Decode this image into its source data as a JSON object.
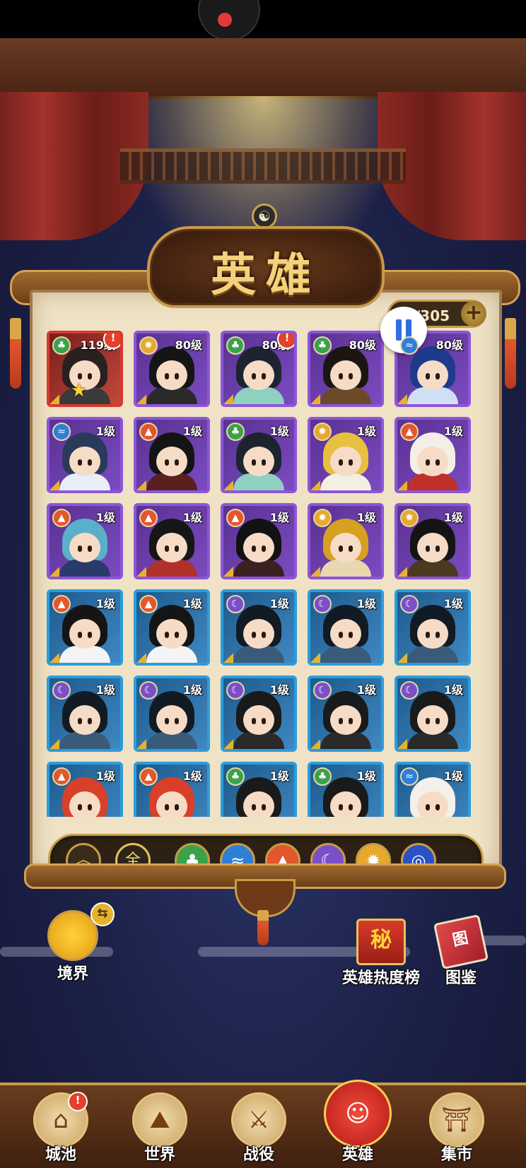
{
  "header": {
    "title": "英雄",
    "hero_count": "/305",
    "add_symbol": "+",
    "yinyang_symbol": "☯"
  },
  "colors": {
    "purple_rarity": "#8e55d8",
    "blue_rarity": "#2c9ddc",
    "red_rarity": "#d63a2e",
    "wood": "#3aa24a",
    "water": "#2f7fd6",
    "fire": "#e2572c",
    "moon": "#7a4fc8",
    "light": "#e6a92e",
    "wind": "#2a52c2"
  },
  "elements": {
    "wood": {
      "glyph": "♣",
      "color": "#3aa24a"
    },
    "water": {
      "glyph": "≈",
      "color": "#2f7fd6"
    },
    "fire": {
      "glyph": "▲",
      "color": "#e2572c"
    },
    "moon": {
      "glyph": "☾",
      "color": "#7a4fc8"
    },
    "light": {
      "glyph": "✹",
      "color": "#e6a92e"
    },
    "wind": {
      "glyph": "◎",
      "color": "#2a52c2"
    }
  },
  "heroes": [
    {
      "level": "119级",
      "element": "wood",
      "rarity": "red",
      "alert": "!",
      "star": "★",
      "hair": "#2a2020",
      "outfit": "#3a3a3a"
    },
    {
      "level": "80级",
      "element": "light",
      "rarity": "purple",
      "hair": "#151515",
      "outfit": "#2a2a2a"
    },
    {
      "level": "80级",
      "element": "wood",
      "rarity": "purple",
      "alert": "!",
      "hair": "#1d2430",
      "outfit": "#8fd0c0"
    },
    {
      "level": "80级",
      "element": "wood",
      "rarity": "purple",
      "hair": "#1b1612",
      "outfit": "#6b4a2a"
    },
    {
      "level": "80级",
      "element": "water",
      "rarity": "purple",
      "hair": "#1f3a8a",
      "outfit": "#cfe0f4"
    },
    {
      "level": "1级",
      "element": "water",
      "rarity": "purple",
      "hair": "#2a3a5a",
      "outfit": "#e8eef6"
    },
    {
      "level": "1级",
      "element": "fire",
      "rarity": "purple",
      "hair": "#141414",
      "outfit": "#5a2020"
    },
    {
      "level": "1级",
      "element": "wood",
      "rarity": "purple",
      "hair": "#1d2430",
      "outfit": "#8fd0c0"
    },
    {
      "level": "1级",
      "element": "light",
      "rarity": "purple",
      "hair": "#e8c040",
      "outfit": "#f4f0e0"
    },
    {
      "level": "1级",
      "element": "fire",
      "rarity": "purple",
      "hair": "#f4eee6",
      "outfit": "#c0302a"
    },
    {
      "level": "1级",
      "element": "fire",
      "rarity": "purple",
      "hair": "#5ab0c8",
      "outfit": "#2a3a6a"
    },
    {
      "level": "1级",
      "element": "fire",
      "rarity": "purple",
      "hair": "#161616",
      "outfit": "#b0302a"
    },
    {
      "level": "1级",
      "element": "fire",
      "rarity": "purple",
      "hair": "#121212",
      "outfit": "#3a2020"
    },
    {
      "level": "1级",
      "element": "light",
      "rarity": "purple",
      "hair": "#d8a020",
      "outfit": "#e8d8b0"
    },
    {
      "level": "1级",
      "element": "light",
      "rarity": "purple",
      "hair": "#141414",
      "outfit": "#4a3a20"
    },
    {
      "level": "1级",
      "element": "fire",
      "rarity": "blue",
      "hair": "#151515",
      "outfit": "#f4f4f4"
    },
    {
      "level": "1级",
      "element": "fire",
      "rarity": "blue",
      "hair": "#151515",
      "outfit": "#f4f4f4"
    },
    {
      "level": "1级",
      "element": "moon",
      "rarity": "blue",
      "hair": "#121a24",
      "outfit": "#3a5a7a"
    },
    {
      "level": "1级",
      "element": "moon",
      "rarity": "blue",
      "hair": "#121a24",
      "outfit": "#3a5a7a"
    },
    {
      "level": "1级",
      "element": "moon",
      "rarity": "blue",
      "hair": "#121a24",
      "outfit": "#3a5a7a"
    },
    {
      "level": "1级",
      "element": "moon",
      "rarity": "blue",
      "hair": "#121a24",
      "outfit": "#3a5a7a"
    },
    {
      "level": "1级",
      "element": "moon",
      "rarity": "blue",
      "hair": "#121a24",
      "outfit": "#3a5a7a"
    },
    {
      "level": "1级",
      "element": "moon",
      "rarity": "blue",
      "hair": "#1a1a1a",
      "outfit": "#2a2a2a"
    },
    {
      "level": "1级",
      "element": "moon",
      "rarity": "blue",
      "hair": "#1a1a1a",
      "outfit": "#2a2a2a"
    },
    {
      "level": "1级",
      "element": "moon",
      "rarity": "blue",
      "hair": "#1a1a1a",
      "outfit": "#2a2a2a"
    },
    {
      "level": "1级",
      "element": "fire",
      "rarity": "blue",
      "hair": "#d8402a",
      "outfit": "#b03020"
    },
    {
      "level": "1级",
      "element": "fire",
      "rarity": "blue",
      "hair": "#d8402a",
      "outfit": "#b03020"
    },
    {
      "level": "1级",
      "element": "wood",
      "rarity": "blue",
      "hair": "#1a1a1a",
      "outfit": "#6ab0a0"
    },
    {
      "level": "1级",
      "element": "wood",
      "rarity": "blue",
      "hair": "#1a1a1a",
      "outfit": "#6ab0a0"
    },
    {
      "level": "1级",
      "element": "water",
      "rarity": "blue",
      "hair": "#f4f0ea",
      "outfit": "#c8302a"
    }
  ],
  "filters": {
    "sort_symbol": "︽",
    "all_label": "全",
    "items": [
      {
        "element": "wood",
        "glyph": "♣",
        "color": "#3aa24a"
      },
      {
        "element": "water",
        "glyph": "≈",
        "color": "#2f7fd6"
      },
      {
        "element": "fire",
        "glyph": "▲",
        "color": "#e2572c"
      },
      {
        "element": "moon",
        "glyph": "☾",
        "color": "#7a4fc8"
      },
      {
        "element": "light",
        "glyph": "✹",
        "color": "#e6a92e"
      },
      {
        "element": "wind",
        "glyph": "◎",
        "color": "#2a52c2"
      }
    ]
  },
  "side": {
    "realm": {
      "label": "境界",
      "swap_symbol": "⇆"
    },
    "ranking": {
      "label": "英雄热度榜",
      "icon_char": "秘"
    },
    "codex": {
      "label": "图鉴",
      "icon_char": "图"
    }
  },
  "nav": [
    {
      "label": "城池",
      "icon": "castle-icon",
      "glyph": "⌂",
      "badge": "!"
    },
    {
      "label": "世界",
      "icon": "world-mountain-icon",
      "glyph": "⛰"
    },
    {
      "label": "战役",
      "icon": "crossed-swords-icon",
      "glyph": "⚔"
    },
    {
      "label": "英雄",
      "icon": "hero-portrait-icon",
      "glyph": "☺",
      "active": true
    },
    {
      "label": "集市",
      "icon": "market-icon",
      "glyph": "⛩"
    }
  ]
}
